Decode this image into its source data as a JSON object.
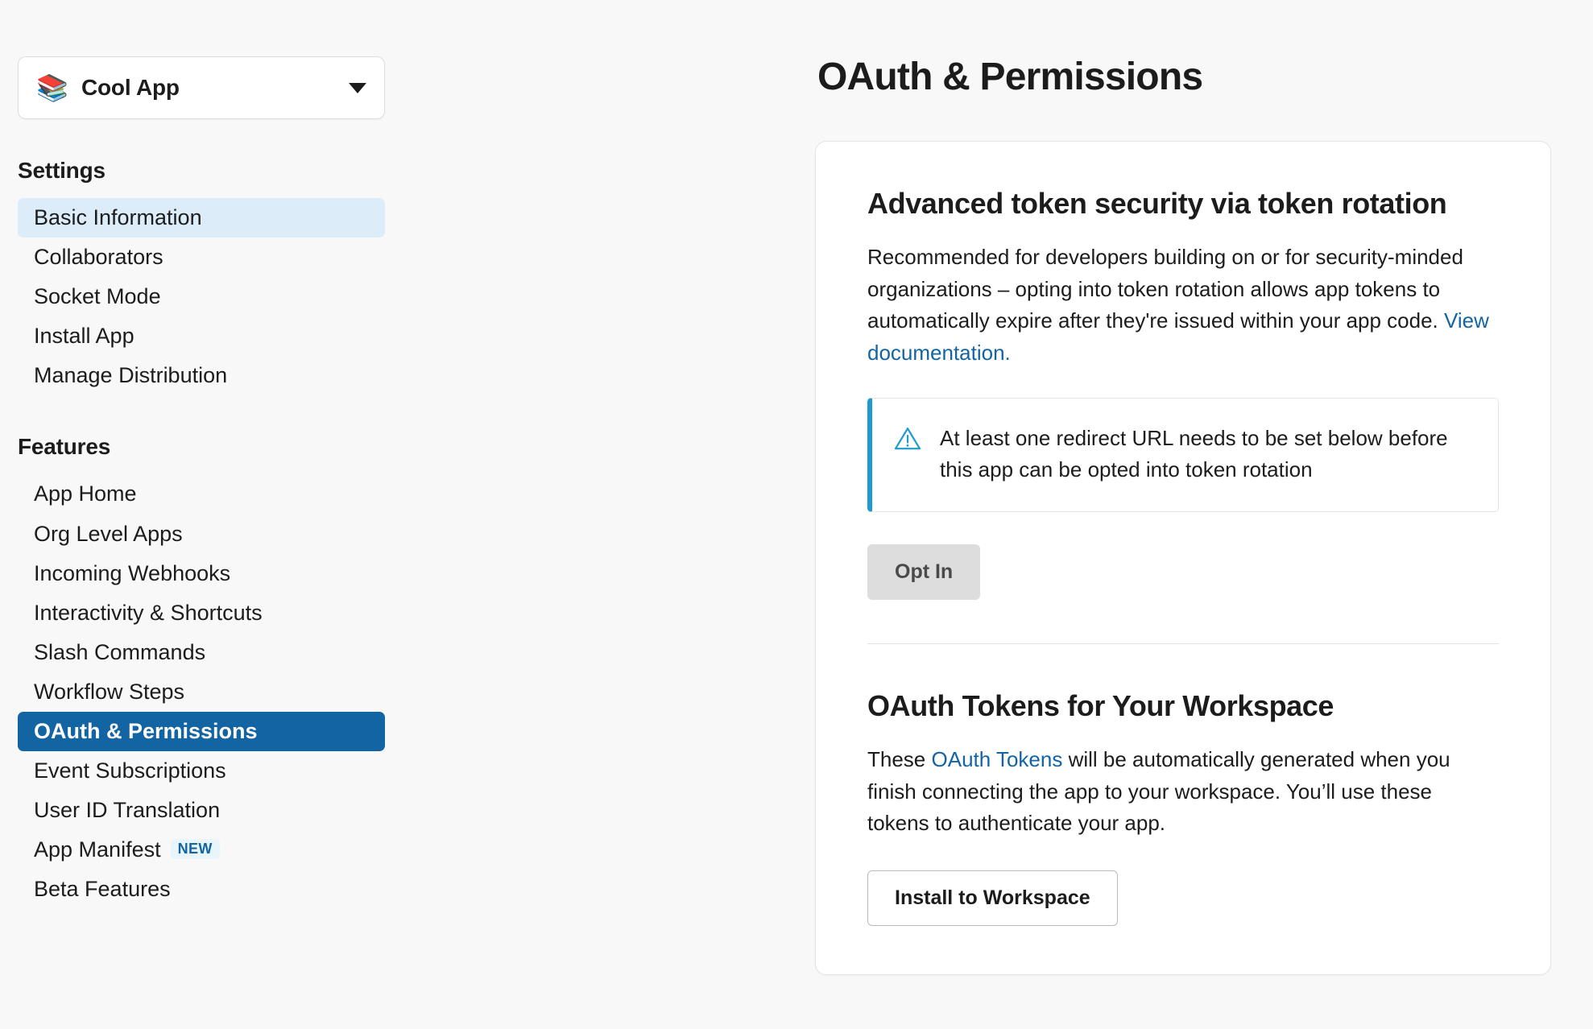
{
  "sidebar": {
    "app_switcher": {
      "icon": "books-icon",
      "icon_glyph": "📚",
      "name": "Cool App",
      "caret": "chevron-down-icon"
    },
    "sections": [
      {
        "title": "Settings",
        "items": [
          {
            "label": "Basic Information",
            "state": "hover"
          },
          {
            "label": "Collaborators",
            "state": "default"
          },
          {
            "label": "Socket Mode",
            "state": "default"
          },
          {
            "label": "Install App",
            "state": "default"
          },
          {
            "label": "Manage Distribution",
            "state": "default"
          }
        ]
      },
      {
        "title": "Features",
        "items": [
          {
            "label": "App Home",
            "state": "default"
          },
          {
            "label": "Org Level Apps",
            "state": "default"
          },
          {
            "label": "Incoming Webhooks",
            "state": "default"
          },
          {
            "label": "Interactivity & Shortcuts",
            "state": "default"
          },
          {
            "label": "Slash Commands",
            "state": "default"
          },
          {
            "label": "Workflow Steps",
            "state": "default"
          },
          {
            "label": "OAuth & Permissions",
            "state": "active"
          },
          {
            "label": "Event Subscriptions",
            "state": "default"
          },
          {
            "label": "User ID Translation",
            "state": "default"
          },
          {
            "label": "App Manifest",
            "state": "default",
            "badge": "NEW"
          },
          {
            "label": "Beta Features",
            "state": "default"
          }
        ]
      }
    ]
  },
  "main": {
    "page_title": "OAuth & Permissions",
    "token_rotation": {
      "heading": "Advanced token security via token rotation",
      "body_before_link": "Recommended for developers building on or for security-minded organizations – opting into token rotation allows app tokens to automatically expire after they're issued within your app code. ",
      "link_label": "View documentation.",
      "alert": {
        "icon": "warning-triangle-icon",
        "text": "At least one redirect URL needs to be set below before this app can be opted into token rotation"
      },
      "opt_in_button": "Opt In"
    },
    "oauth_tokens": {
      "heading": "OAuth Tokens for Your Workspace",
      "body_prefix": "These ",
      "link_label": "OAuth Tokens",
      "body_suffix": " will be automatically generated when you finish connecting the app to your workspace. You’ll use these tokens to authenticate your app.",
      "install_button": "Install to Workspace"
    }
  },
  "colors": {
    "accent_blue": "#1264A3",
    "alert_blue": "#1D9BD1",
    "badge_bg": "#E8F5FB",
    "page_bg": "#F8F8F8",
    "card_bg": "#FFFFFF",
    "text": "#1D1C1D",
    "hover_bg": "#DCEDF9"
  }
}
